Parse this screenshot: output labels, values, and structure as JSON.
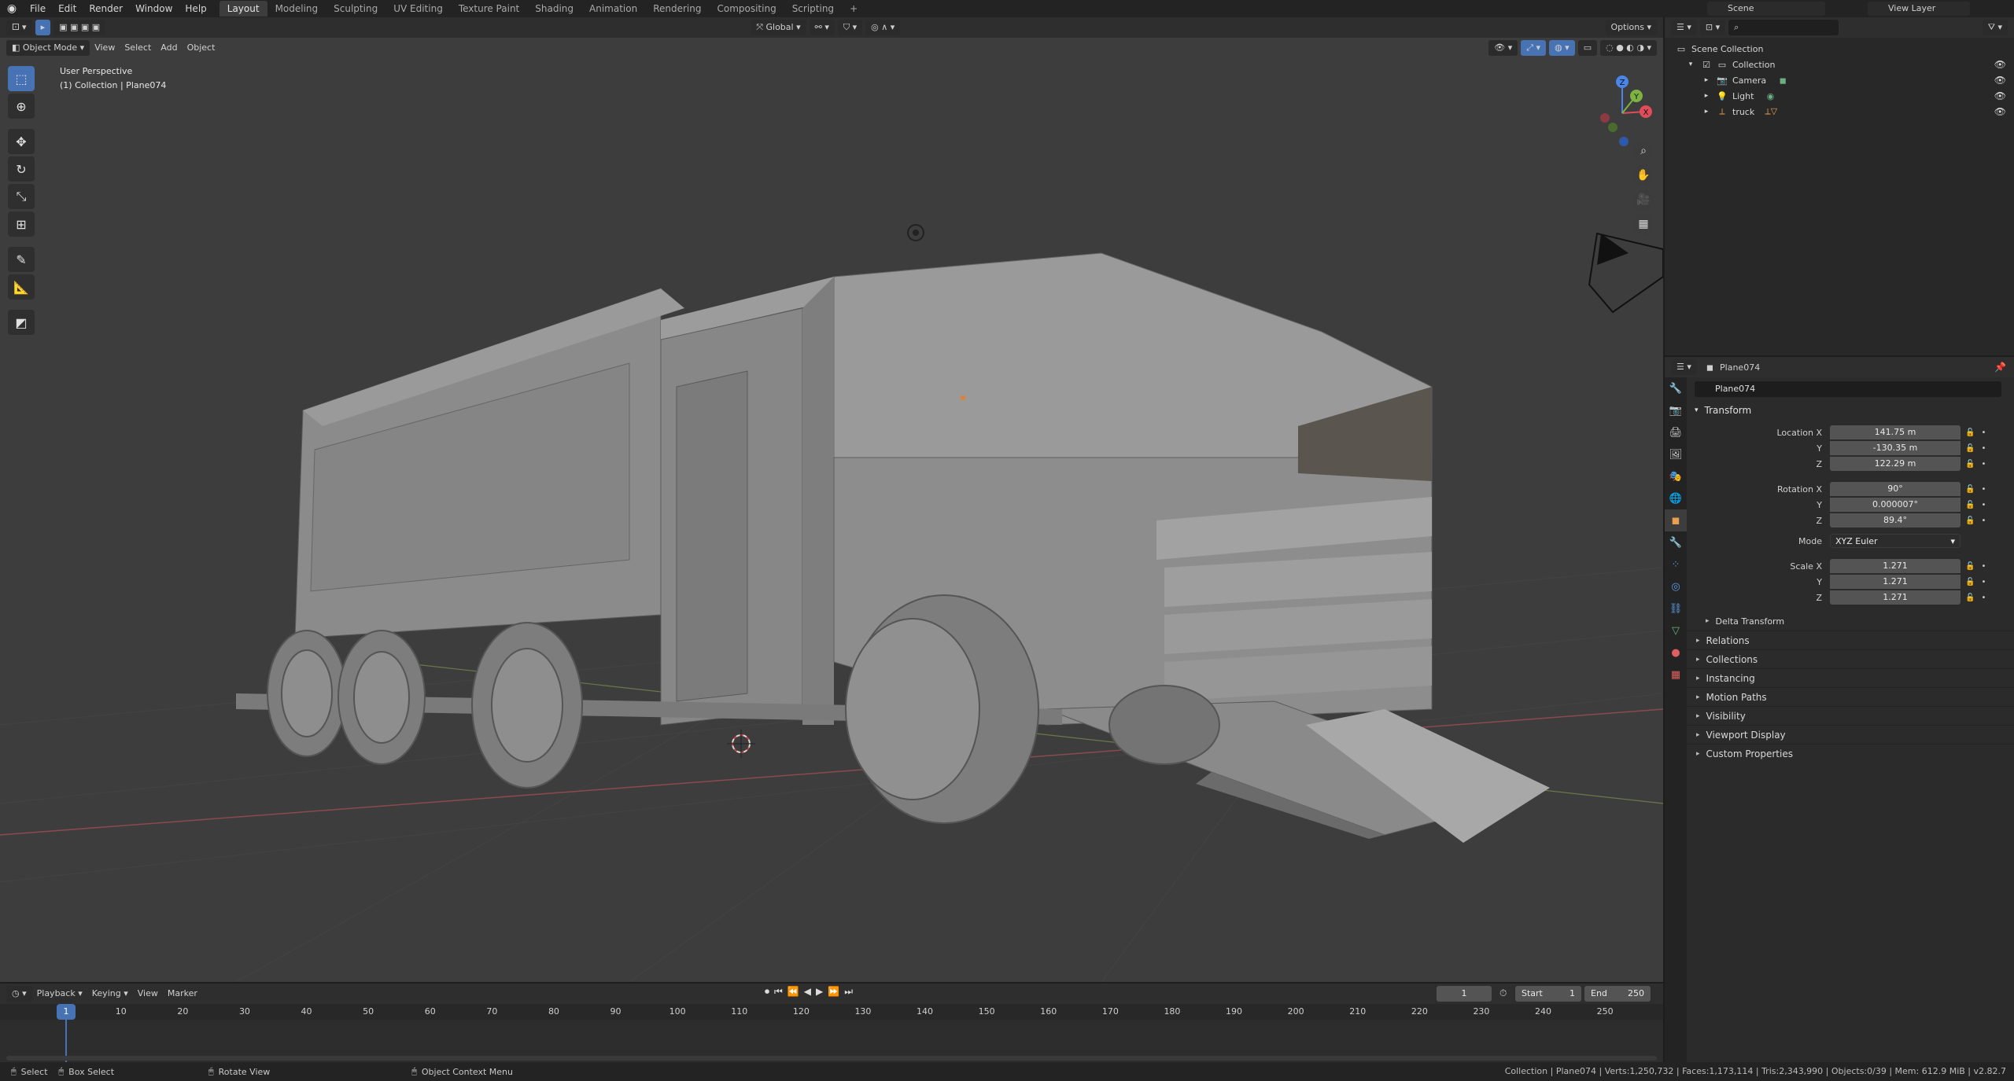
{
  "topbar": {
    "menus": [
      "File",
      "Edit",
      "Render",
      "Window",
      "Help"
    ],
    "workspaces": [
      "Layout",
      "Modeling",
      "Sculpting",
      "UV Editing",
      "Texture Paint",
      "Shading",
      "Animation",
      "Rendering",
      "Compositing",
      "Scripting"
    ],
    "active_workspace": "Layout",
    "add_tab": "+",
    "scene": "Scene",
    "view_layer": "View Layer"
  },
  "viewport": {
    "mode": "Object Mode",
    "menus": [
      "View",
      "Select",
      "Add",
      "Object"
    ],
    "orientation": "Global",
    "options": "Options",
    "overlay_line1": "User Perspective",
    "overlay_line2": "(1) Collection | Plane074",
    "gizmo": {
      "z": "Z",
      "y": "Y",
      "x": "X"
    }
  },
  "outliner": {
    "root": "Scene Collection",
    "collection": "Collection",
    "items": [
      "Camera",
      "Light",
      "truck"
    ]
  },
  "properties": {
    "header_object": "Plane074",
    "object_name": "Plane074",
    "transform_title": "Transform",
    "location_label": "Location X",
    "location": [
      "141.75 m",
      "-130.35 m",
      "122.29 m"
    ],
    "rotation_label": "Rotation X",
    "rotation": [
      "90°",
      "0.000007°",
      "89.4°"
    ],
    "mode_label": "Mode",
    "mode_value": "XYZ Euler",
    "scale_label": "Scale X",
    "scale": [
      "1.271",
      "1.271",
      "1.271"
    ],
    "axis_y": "Y",
    "axis_z": "Z",
    "delta_transform": "Delta Transform",
    "panels": [
      "Relations",
      "Collections",
      "Instancing",
      "Motion Paths",
      "Visibility",
      "Viewport Display",
      "Custom Properties"
    ]
  },
  "timeline": {
    "menus": [
      "Playback",
      "Keying",
      "View",
      "Marker"
    ],
    "current_frame": "1",
    "start_label": "Start",
    "start": "1",
    "end_label": "End",
    "end": "250",
    "playhead": "1",
    "ticks": [
      "10",
      "20",
      "30",
      "40",
      "50",
      "60",
      "70",
      "80",
      "90",
      "100",
      "110",
      "120",
      "130",
      "140",
      "150",
      "160",
      "170",
      "180",
      "190",
      "200",
      "210",
      "220",
      "230",
      "240",
      "250"
    ]
  },
  "statusbar": {
    "select": "Select",
    "box_select": "Box Select",
    "rotate_view": "Rotate View",
    "context_menu": "Object Context Menu",
    "stats": "Collection | Plane074 | Verts:1,250,732 | Faces:1,173,114 | Tris:2,343,990 | Objects:0/39 | Mem: 612.9 MiB | v2.82.7"
  },
  "colors": {
    "accent": "#4772b3",
    "viewport_bg": "#3d3d3d",
    "axis_x": "#e04d5a",
    "axis_y": "#7cb342",
    "axis_z": "#4a86e8"
  }
}
